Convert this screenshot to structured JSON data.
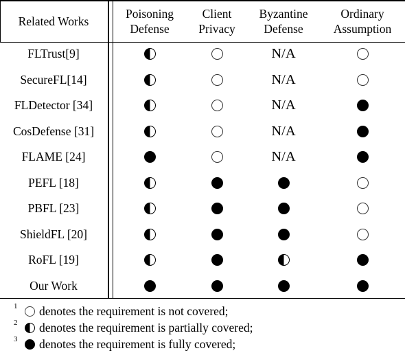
{
  "table": {
    "columns": [
      {
        "key": "work",
        "label_lines": [
          "Related Works"
        ]
      },
      {
        "key": "poisoning",
        "label_lines": [
          "Poisoning",
          "Defense"
        ]
      },
      {
        "key": "privacy",
        "label_lines": [
          "Client",
          "Privacy"
        ]
      },
      {
        "key": "byzantine",
        "label_lines": [
          "Byzantine",
          "Defense"
        ]
      },
      {
        "key": "ordinary",
        "label_lines": [
          "Ordinary",
          "Assumption"
        ]
      }
    ],
    "rows": [
      {
        "work": "FLTrust[9]",
        "poisoning": "partial",
        "privacy": "none",
        "byzantine": "N/A",
        "ordinary": "none"
      },
      {
        "work": "SecureFL[14]",
        "poisoning": "partial",
        "privacy": "none",
        "byzantine": "N/A",
        "ordinary": "none"
      },
      {
        "work": "FLDetector [34]",
        "poisoning": "partial",
        "privacy": "none",
        "byzantine": "N/A",
        "ordinary": "full"
      },
      {
        "work": "CosDefense [31]",
        "poisoning": "partial",
        "privacy": "none",
        "byzantine": "N/A",
        "ordinary": "full"
      },
      {
        "work": "FLAME [24]",
        "poisoning": "full",
        "privacy": "none",
        "byzantine": "N/A",
        "ordinary": "full"
      },
      {
        "work": "PEFL [18]",
        "poisoning": "partial",
        "privacy": "full",
        "byzantine": "full",
        "ordinary": "none"
      },
      {
        "work": "PBFL [23]",
        "poisoning": "partial",
        "privacy": "full",
        "byzantine": "full",
        "ordinary": "none"
      },
      {
        "work": "ShieldFL [20]",
        "poisoning": "partial",
        "privacy": "full",
        "byzantine": "full",
        "ordinary": "none"
      },
      {
        "work": "RoFL [19]",
        "poisoning": "partial",
        "privacy": "full",
        "byzantine": "partial",
        "ordinary": "full"
      },
      {
        "work": "Our Work",
        "poisoning": "full",
        "privacy": "full",
        "byzantine": "full",
        "ordinary": "full"
      }
    ]
  },
  "symbols": {
    "none": "empty-circle-icon",
    "partial": "half-filled-circle-icon",
    "full": "filled-circle-icon"
  },
  "footnotes": [
    {
      "num": "1",
      "symbol": "none",
      "text": "denotes the requirement is not covered;"
    },
    {
      "num": "2",
      "symbol": "partial",
      "text": "denotes the requirement is partially covered;"
    },
    {
      "num": "3",
      "symbol": "full",
      "text": "denotes the requirement is fully covered;"
    }
  ]
}
